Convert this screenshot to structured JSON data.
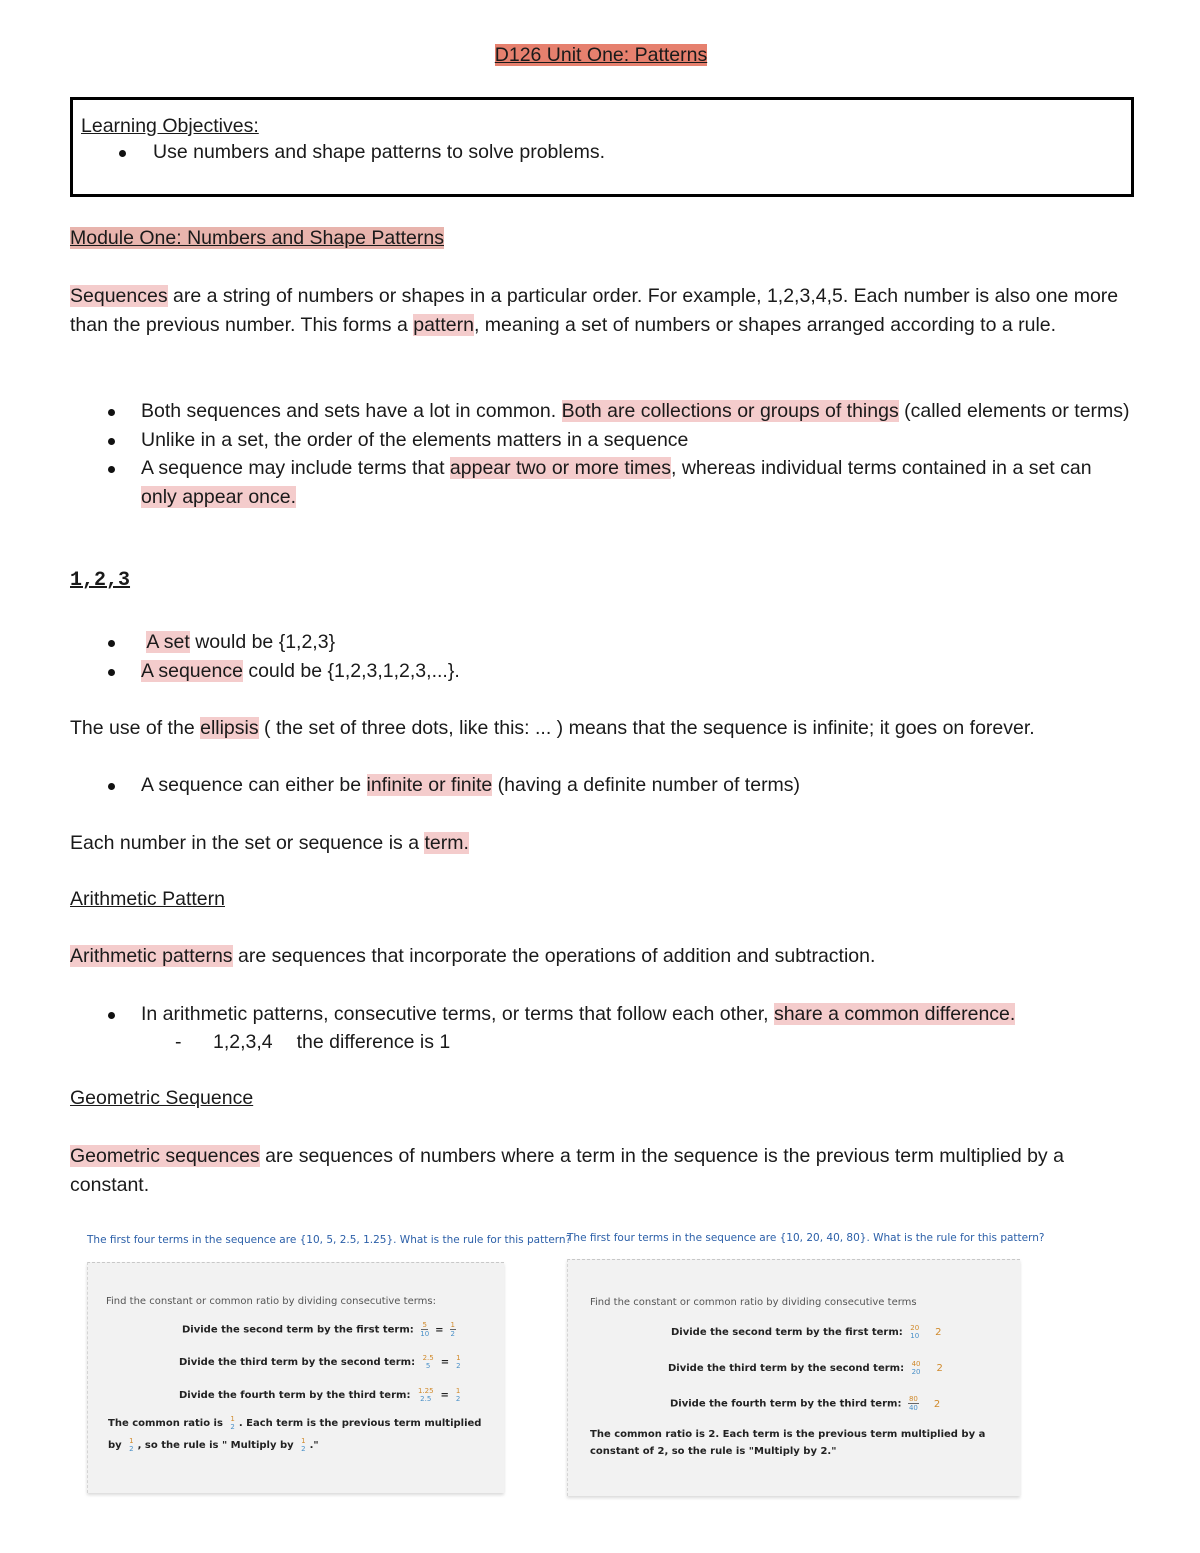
{
  "title": "D126 Unit One: Patterns",
  "objectives": {
    "label": "Learning Objectives:",
    "items": [
      "Use numbers and shape patterns to solve problems."
    ]
  },
  "module": {
    "heading": "Module One: Numbers and Shape Patterns",
    "intro": {
      "t1": "Sequences",
      "t2": " are a string of numbers or shapes in a particular order. For example, 1,2,3,4,5. Each number is also one more than the previous number. This forms a ",
      "t3": "pattern",
      "t4": ", meaning a set of numbers or shapes arranged according to a rule."
    },
    "bullets": [
      {
        "a": "Both sequences and sets have a lot in common. ",
        "h": "Both are collections or groups of things",
        "b": " (called elements or terms)"
      },
      {
        "a": "Unlike in a set, the order of the elements matters in a sequence",
        "h": "",
        "b": ""
      },
      {
        "a": "A sequence may include terms that ",
        "h": "appear two or more times",
        "b": ", whereas individual terms contained in a set can ",
        "h2": "only appear once."
      }
    ]
  },
  "example": {
    "heading": "1,2,3",
    "items": [
      {
        "h": "A set",
        "t": " would be {1,2,3}"
      },
      {
        "h": "A sequence",
        "t": " could be {1,2,3,1,2,3,...}."
      }
    ]
  },
  "ellipsis": {
    "a": "The use of the ",
    "h": "ellipsis",
    "b": " ( the set of three dots, like this: ... ) means that the sequence is infinite; it goes on forever.",
    "bullet": {
      "a": "A sequence can either be ",
      "h": "infinite or finite",
      "b": " (having a definite number of terms)"
    }
  },
  "term": {
    "a": "Each number in the set or sequence is a ",
    "h": "term."
  },
  "arithmetic": {
    "heading": "Arithmetic Pattern",
    "def_h": "Arithmetic patterns",
    "def_t": " are sequences that incorporate the operations of addition and subtraction.",
    "bullet_a": "In arithmetic patterns, consecutive terms, or terms that follow each other, ",
    "bullet_h": "share a common difference.",
    "sub_dash": "-",
    "sub_example": "1,2,3,4",
    "sub_text": "the difference is 1"
  },
  "geometric": {
    "heading": "Geometric Sequence",
    "def_h": "Geometric sequences",
    "def_t": " are sequences of numbers where a term in the sequence is the previous term multiplied by a constant."
  },
  "examples": [
    {
      "question": "The first four terms in the sequence are {10, 5, 2.5, 1.25}. What is the rule for this pattern?",
      "intro": "Find the constant or common ratio by dividing consecutive terms:",
      "steps": [
        {
          "label": "Divide the second term by the first term:",
          "num": "5",
          "den": "10",
          "eq": "=",
          "rnum": "1",
          "rden": "2"
        },
        {
          "label": "Divide the third term by the second term:",
          "num": "2.5",
          "den": "5",
          "eq": "=",
          "rnum": "1",
          "rden": "2"
        },
        {
          "label": "Divide the fourth term by the third term:",
          "num": "1.25",
          "den": "2.5",
          "eq": "=",
          "rnum": "1",
          "rden": "2"
        }
      ],
      "conclusion": {
        "a": "The common ratio is ",
        "f1n": "1",
        "f1d": "2",
        "b": ". Each term is the previous term multiplied by ",
        "f2n": "1",
        "f2d": "2",
        "c": ", so the rule is \" Multiply by ",
        "f3n": "1",
        "f3d": "2",
        "d": ".\""
      }
    },
    {
      "question": "The first four terms in the sequence are {10, 20, 40, 80}. What is the rule for this pattern?",
      "intro": "Find the constant or common ratio by dividing consecutive terms",
      "steps": [
        {
          "label": "Divide the second term by the first term:",
          "num": "20",
          "den": "10",
          "eq": "=",
          "result": "2"
        },
        {
          "label": "Divide the third term by the second term:",
          "num": "40",
          "den": "20",
          "eq": "=",
          "result": "2"
        },
        {
          "label": "Divide the fourth term by the third term:",
          "num": "80",
          "den": "40",
          "eq": "=",
          "result": "2"
        }
      ],
      "conclusion": {
        "line1": "The common ratio is 2. Each term is the previous term multiplied by a",
        "line2": "constant of 2, so the rule is \"Multiply by 2.\""
      }
    }
  ]
}
